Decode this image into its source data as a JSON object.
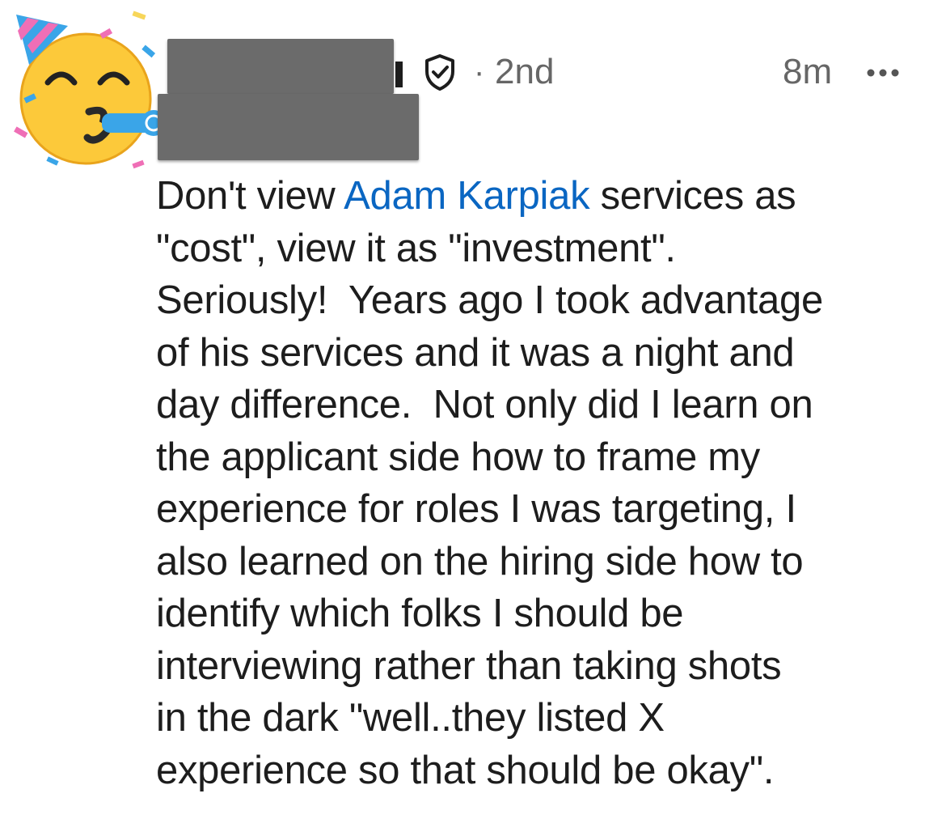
{
  "comment_header": {
    "degree": "2nd",
    "separator": "·",
    "timestamp": "8m",
    "more_label": "···"
  },
  "avatar": {
    "icon": "partying-face-emoji-icon"
  },
  "verified_icon": "shield-check-icon",
  "comment": {
    "line1_before": "Don't view ",
    "mention": "Adam Karpiak",
    "line1_after": " services as",
    "lines": [
      "\"cost\", view it as \"investment\".",
      "Seriously!  Years ago I took advantage",
      "of his services and it was a night and",
      "day difference.  Not only did I learn on",
      "the applicant side how to frame my",
      "experience for roles I was targeting, I",
      "also learned on the hiring side how to",
      "identify which folks I should be",
      "interviewing rather than taking shots",
      "in the dark \"well..they listed X",
      "experience so that should be okay\"."
    ]
  },
  "colors": {
    "text": "#1d1d1d",
    "meta": "#666666",
    "mention": "#0a66c2",
    "redaction": "#6b6b6b"
  }
}
